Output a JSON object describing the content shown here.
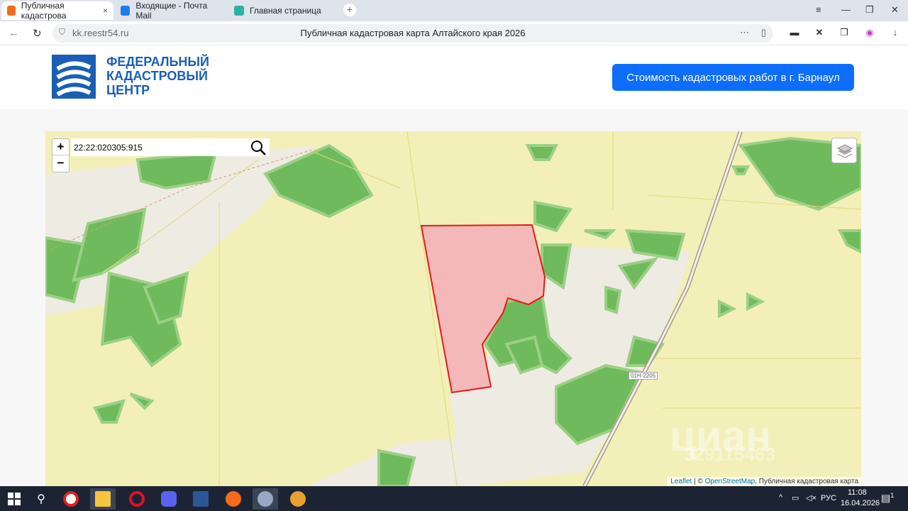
{
  "browser": {
    "tabs": [
      {
        "label": "Публичная кадастрова",
        "active": true,
        "icon_color": "#f26c1a"
      },
      {
        "label": "Входящие - Почта Mail",
        "active": false,
        "icon_color": "#1e7cf2"
      },
      {
        "label": "Главная страница",
        "active": false,
        "icon_color": "#2bb3a0"
      }
    ],
    "url": "kk.reestr54.ru",
    "page_title": "Публичная кадастровая карта Алтайского края 2026"
  },
  "header": {
    "logo_lines": [
      "ФЕДЕРАЛЬНЫЙ",
      "КАДАСТРОВЫЙ",
      "ЦЕНТР"
    ],
    "cta_label": "Стоимость кадастровых работ в г. Барнаул",
    "brand_color": "#1a5fb4",
    "cta_color": "#0d6efd"
  },
  "map": {
    "search_value": "22:22:020305:915",
    "zoom_in": "+",
    "zoom_out": "−",
    "road_label": "01Н-2205",
    "watermark": "циан",
    "watermark_id": "329115463",
    "attribution": {
      "leaflet": "Leaflet",
      "sep": " | © ",
      "osm": "OpenStreetMap",
      "rest": ", Публичная кадастровая карта"
    },
    "parcel_color": "#e31a1c"
  },
  "taskbar": {
    "lang": "РУС",
    "time": "11:08",
    "date": "16.04.2026",
    "notifications": "1"
  }
}
